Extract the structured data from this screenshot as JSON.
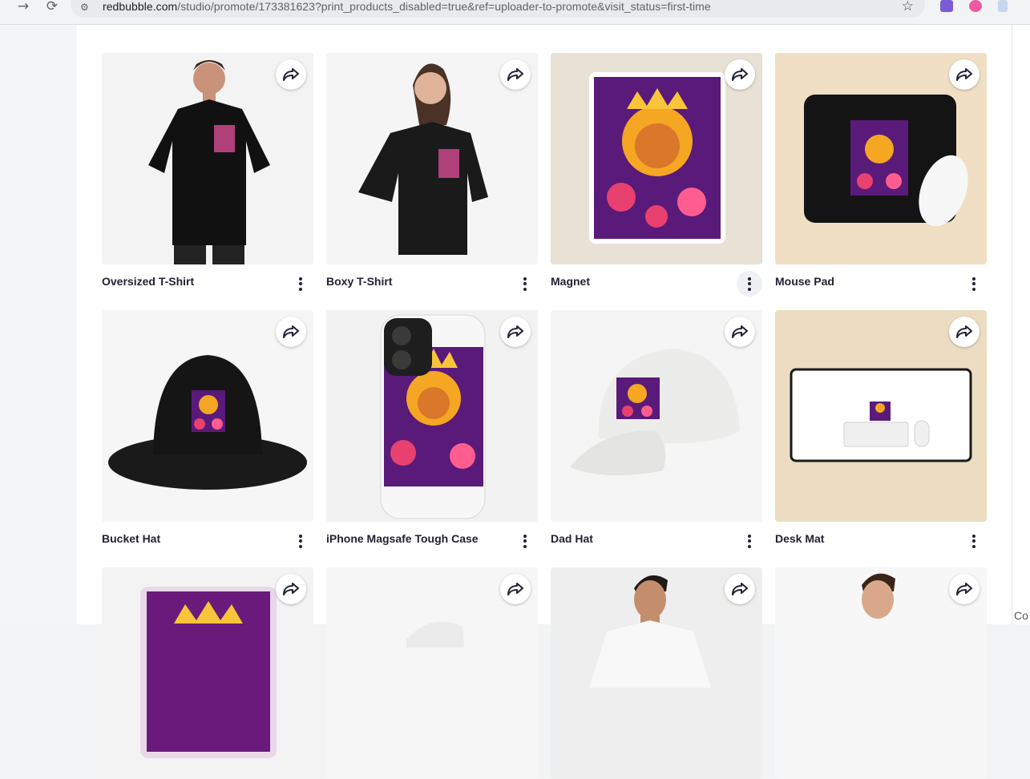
{
  "browser": {
    "back": "←",
    "forward": "→",
    "reload": "⟳",
    "url_domain": "redbubble.com",
    "url_path": "/studio/promote/173381623?print_products_disabled=true&ref=uploader-to-promote&visit_status=first-time",
    "bookmark_icon": "star-icon"
  },
  "products": [
    {
      "title": "Oversized T-Shirt",
      "image": "black-oversized-tshirt-model"
    },
    {
      "title": "Boxy T-Shirt",
      "image": "black-boxy-tshirt-model"
    },
    {
      "title": "Magnet",
      "image": "lion-crown-magnet"
    },
    {
      "title": "Mouse Pad",
      "image": "black-mouse-pad"
    },
    {
      "title": "Bucket Hat",
      "image": "black-bucket-hat"
    },
    {
      "title": "iPhone Magsafe Tough Case",
      "image": "white-iphone-case"
    },
    {
      "title": "Dad Hat",
      "image": "white-dad-hat"
    },
    {
      "title": "Desk Mat",
      "image": "white-desk-mat"
    },
    {
      "title": "",
      "image": "sticker-partial"
    },
    {
      "title": "",
      "image": "white-hat-partial"
    },
    {
      "title": "",
      "image": "man-tshirt-partial"
    },
    {
      "title": "",
      "image": "man-shirt-partial"
    }
  ],
  "corner_text": "Co"
}
